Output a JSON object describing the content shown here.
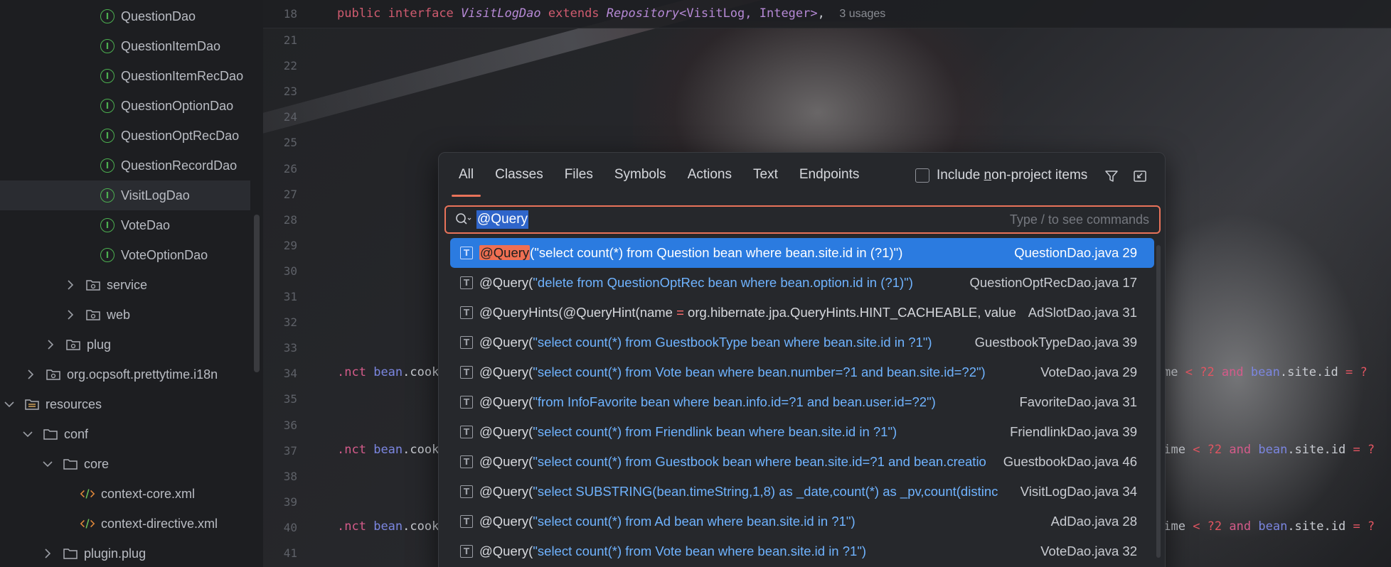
{
  "tree": {
    "items": [
      {
        "label": "QuestionDao",
        "kind": "interface"
      },
      {
        "label": "QuestionItemDao",
        "kind": "interface"
      },
      {
        "label": "QuestionItemRecDao",
        "kind": "interface"
      },
      {
        "label": "QuestionOptionDao",
        "kind": "interface"
      },
      {
        "label": "QuestionOptRecDao",
        "kind": "interface"
      },
      {
        "label": "QuestionRecordDao",
        "kind": "interface"
      },
      {
        "label": "VisitLogDao",
        "kind": "interface",
        "selected": true
      },
      {
        "label": "VoteDao",
        "kind": "interface"
      },
      {
        "label": "VoteOptionDao",
        "kind": "interface"
      },
      {
        "label": "service",
        "kind": "package"
      },
      {
        "label": "web",
        "kind": "package"
      },
      {
        "label": "plug",
        "kind": "package"
      },
      {
        "label": "org.ocpsoft.prettytime.i18n",
        "kind": "package"
      },
      {
        "label": "resources",
        "kind": "resource-folder"
      },
      {
        "label": "conf",
        "kind": "folder"
      },
      {
        "label": "core",
        "kind": "folder"
      },
      {
        "label": "context-core.xml",
        "kind": "xml"
      },
      {
        "label": "context-directive.xml",
        "kind": "xml"
      },
      {
        "label": "plugin.plug",
        "kind": "folder"
      }
    ]
  },
  "editor": {
    "header": {
      "line": "18",
      "kw1": "public",
      "kw2": "interface",
      "name": "VisitLogDao",
      "kw3": "extends",
      "base": "Repository",
      "generic": "<VisitLog, Integer>",
      "comma": ",",
      "usages": "3 usages"
    },
    "line_numbers": [
      "21",
      "22",
      "23",
      "24",
      "25",
      "26",
      "27",
      "28",
      "29",
      "30",
      "31",
      "32",
      "33",
      "34",
      "35",
      "36",
      "37",
      "38",
      "39",
      "40",
      "41"
    ],
    "fragments": {
      "l34_left": ".nct bean.cooki",
      "l37_left": ".nct bean.cook",
      "l40_left": ".nct bean.cook",
      "l34_right": "me < ?2 and bean.site.id = ?",
      "l37_right": "time < ?2 and bean.site.id = ?",
      "l40_right": "time < ?2 and bean.site.id = ?"
    }
  },
  "popup": {
    "tabs": [
      "All",
      "Classes",
      "Files",
      "Symbols",
      "Actions",
      "Text",
      "Endpoints"
    ],
    "active_tab": "All",
    "include_label_pre": "Include ",
    "include_label_u": "n",
    "include_label_post": "on-project items",
    "search_value": "@Query",
    "search_hint": "Type / to see commands",
    "results": [
      {
        "prefix": "@Query",
        "rest": "(\"select count(*) from Question bean where bean.site.id in (?1)\")",
        "file": "QuestionDao.java 29",
        "selected": true
      },
      {
        "prefix": "@Query",
        "rest": "(\"delete from QuestionOptRec bean where bean.option.id in (?1)\")",
        "file": "QuestionOptRecDao.java 17"
      },
      {
        "prefix": "@QueryHints",
        "rest": "(@QueryHint(name = org.hibernate.jpa.QueryHints.HINT_CACHEABLE, value",
        "file": "AdSlotDao.java 31"
      },
      {
        "prefix": "@Query",
        "rest": "(\"select count(*) from GuestbookType bean where bean.site.id in ?1\")",
        "file": "GuestbookTypeDao.java 39"
      },
      {
        "prefix": "@Query",
        "rest": "(\"select count(*) from Vote bean where bean.number=?1 and bean.site.id=?2\")",
        "file": "VoteDao.java 29"
      },
      {
        "prefix": "@Query",
        "rest": "(\"from InfoFavorite bean where bean.info.id=?1 and bean.user.id=?2\")",
        "file": "FavoriteDao.java 31"
      },
      {
        "prefix": "@Query",
        "rest": "(\"select count(*) from Friendlink bean where bean.site.id in ?1\")",
        "file": "FriendlinkDao.java 39"
      },
      {
        "prefix": "@Query",
        "rest": "(\"select count(*) from Guestbook bean where bean.site.id=?1 and bean.creatio",
        "file": "GuestbookDao.java 46"
      },
      {
        "prefix": "@Query",
        "rest": "(\"select SUBSTRING(bean.timeString,1,8) as _date,count(*) as _pv,count(distinc",
        "file": "VisitLogDao.java 34"
      },
      {
        "prefix": "@Query",
        "rest": "(\"select count(*) from Ad bean where bean.site.id in ?1\")",
        "file": "AdDao.java 28"
      },
      {
        "prefix": "@Query",
        "rest": "(\"select count(*) from Vote bean where bean.site.id in ?1\")",
        "file": "VoteDao.java 32"
      }
    ]
  },
  "colors": {
    "accent": "#e8735a",
    "selection": "#2b7be0",
    "interface_icon": "#4caf50"
  }
}
